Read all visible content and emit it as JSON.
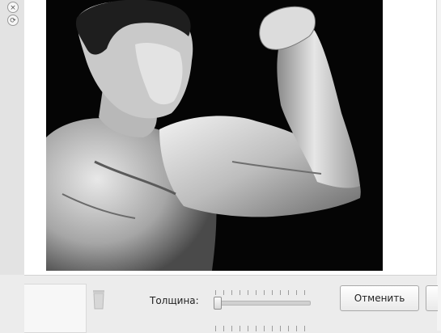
{
  "toolbar": {
    "icons": [
      "close-icon",
      "reload-icon"
    ],
    "close_glyph": "×",
    "reload_glyph": "⟳"
  },
  "canvas": {
    "image_subject": "bodybuilder-flexing-photo"
  },
  "controls": {
    "thickness_label": "Толщина:",
    "thickness_value": 0.0,
    "cancel_label": "Отменить"
  },
  "colors": {
    "background": "#ececec",
    "canvas": "#ffffff",
    "photo_background": "#050505"
  }
}
